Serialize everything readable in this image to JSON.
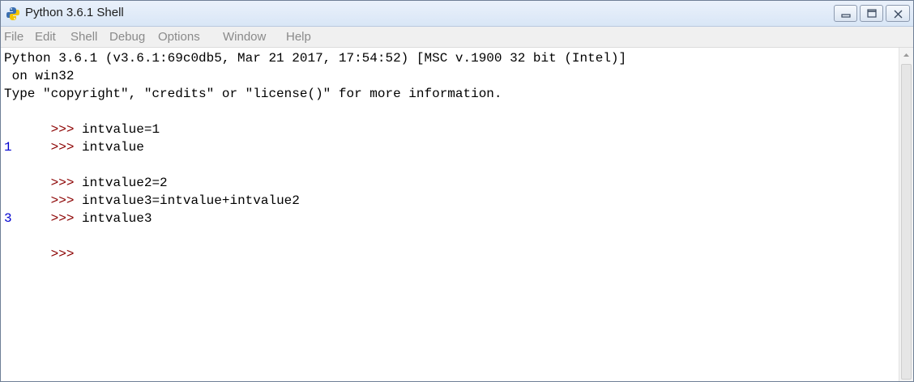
{
  "window": {
    "title": "Python 3.6.1 Shell"
  },
  "menu": {
    "items": [
      "File",
      "Edit",
      "Shell",
      "Debug",
      "Options",
      "Window",
      "Help"
    ]
  },
  "shell": {
    "banner_line1": "Python 3.6.1 (v3.6.1:69c0db5, Mar 21 2017, 17:54:52) [MSC v.1900 32 bit (Intel)]",
    "banner_line2": " on win32",
    "banner_line3": "Type \"copyright\", \"credits\" or \"license()\" for more information.",
    "prompt": ">>>",
    "entries": [
      {
        "input": "intvalue=1"
      },
      {
        "input": "intvalue",
        "output": "1"
      },
      {
        "input": "intvalue2=2"
      },
      {
        "input": "intvalue3=intvalue+intvalue2"
      },
      {
        "input": "intvalue3",
        "output": "3"
      }
    ]
  },
  "icons": {
    "app": "python-icon",
    "minimize": "minimize-icon",
    "maximize": "maximize-icon",
    "close": "close-icon",
    "scroll_up": "scroll-up-arrow-icon"
  },
  "colors": {
    "prompt": "#8b0000",
    "result": "#0000d0",
    "text": "#000000",
    "menu_text": "#8a8a8a"
  }
}
